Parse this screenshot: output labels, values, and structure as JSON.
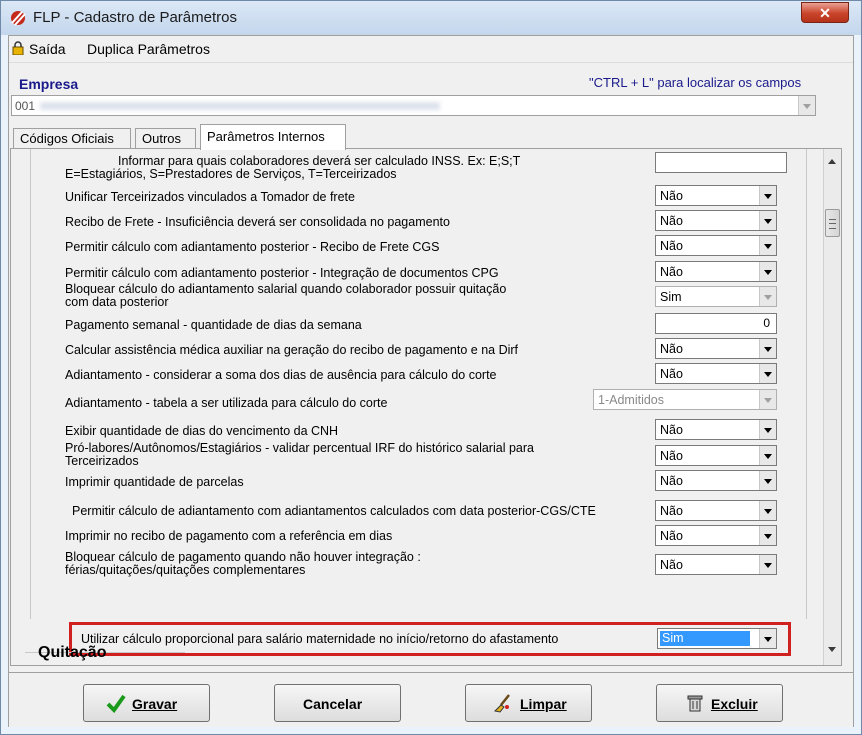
{
  "window": {
    "title": "FLP - Cadastro de Parâmetros"
  },
  "menu": {
    "items": [
      "Saída",
      "Duplica Parâmetros"
    ]
  },
  "empresa": {
    "label": "Empresa",
    "hint": "\"CTRL + L\" para localizar os campos",
    "code": "001"
  },
  "tabs": [
    "Códigos Oficiais",
    "Outros",
    "Parâmetros Internos"
  ],
  "params": {
    "p0": {
      "label1": "Informar para quais colaboradores deverá ser calculado INSS. Ex: E;S;T",
      "label2": "E=Estagiários, S=Prestadores de Serviços, T=Terceirizados"
    },
    "p1": {
      "label": "Unificar Terceirizados vinculados a Tomador de frete",
      "value": "Não"
    },
    "p2": {
      "label": "Recibo de Frete - Insuficiência deverá ser consolidada no pagamento",
      "value": "Não"
    },
    "p3": {
      "label": "Permitir cálculo com adiantamento posterior - Recibo de Frete CGS",
      "value": "Não"
    },
    "p4": {
      "label": "Permitir cálculo com adiantamento posterior - Integração de documentos CPG",
      "value": "Não"
    },
    "p5": {
      "label1": "Bloquear cálculo do adiantamento salarial quando colaborador possuir quitação",
      "label2": "com data posterior",
      "value": "Sim"
    },
    "p6": {
      "label": "Pagamento semanal - quantidade de dias da semana",
      "value": "0"
    },
    "p7": {
      "label": "Calcular assistência médica auxiliar na geração do recibo de pagamento e na Dirf",
      "value": "Não"
    },
    "p8": {
      "label": "Adiantamento - considerar a soma dos dias de ausência para cálculo do corte",
      "value": "Não"
    },
    "p9": {
      "label": "Adiantamento - tabela a ser utilizada para cálculo do corte",
      "value": "1-Admitidos"
    },
    "p10": {
      "label": "Exibir quantidade de dias do vencimento da CNH",
      "value": "Não"
    },
    "p11": {
      "label1": "Pró-labores/Autônomos/Estagiários - validar percentual IRF do  histórico salarial para",
      "label2": "Terceirizados",
      "value": "Não"
    },
    "p12": {
      "label": "Imprimir quantidade de parcelas",
      "value": "Não"
    },
    "p13": {
      "label": "Permitir cálculo de adiantamento com adiantamentos calculados com data posterior-CGS/CTE",
      "value": "Não"
    },
    "p14": {
      "label": "Imprimir no recibo de pagamento com a referência em dias",
      "value": "Não"
    },
    "p15": {
      "label1": "Bloquear cálculo de pagamento quando não houver integração :",
      "label2": "férias/quitações/quitações complementares",
      "value": "Não"
    },
    "p16": {
      "label": "Utilizar cálculo proporcional para salário maternidade no início/retorno do afastamento",
      "value": "Sim"
    }
  },
  "section": {
    "quitacao": "Quitação"
  },
  "buttons": {
    "gravar": "Gravar",
    "cancelar": "Cancelar",
    "limpar": "Limpar",
    "excluir": "Excluir"
  },
  "colors": {
    "highlight": "#d02020",
    "selection": "#3399ff",
    "label_blue": "#1a1a8c"
  }
}
